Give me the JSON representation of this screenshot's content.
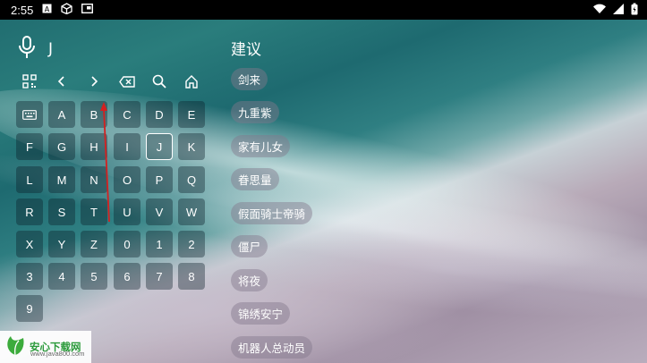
{
  "status_bar": {
    "time": "2:55",
    "icons_left": [
      "a-icon",
      "cube-icon",
      "tv-icon"
    ],
    "icons_right": [
      "wifi-icon",
      "signal-icon",
      "battery-icon"
    ]
  },
  "search": {
    "query": "J"
  },
  "toolbar": {
    "icons": [
      "qr-code-icon",
      "chevron-left-icon",
      "chevron-right-icon",
      "backspace-icon",
      "search-icon",
      "home-icon"
    ]
  },
  "keyboard": {
    "rows": [
      [
        "keyboard-icon",
        "A",
        "B",
        "C",
        "D",
        "E"
      ],
      [
        "F",
        "G",
        "H",
        "I",
        "J",
        "K"
      ],
      [
        "L",
        "M",
        "N",
        "O",
        "P",
        "Q"
      ],
      [
        "R",
        "S",
        "T",
        "U",
        "V",
        "W"
      ],
      [
        "X",
        "Y",
        "Z",
        "0",
        "1",
        "2"
      ],
      [
        "3",
        "4",
        "5",
        "6",
        "7",
        "8"
      ],
      [
        "9"
      ]
    ],
    "selected": "J"
  },
  "suggestions": {
    "title": "建议",
    "items": [
      "剑来",
      "九重紫",
      "家有儿女",
      "眷思量",
      "假面骑士帝骑",
      "僵尸",
      "将夜",
      "锦绣安宁",
      "机器人总动员"
    ]
  },
  "watermark": {
    "name": "安心下载网",
    "url": "www.java800.com"
  }
}
